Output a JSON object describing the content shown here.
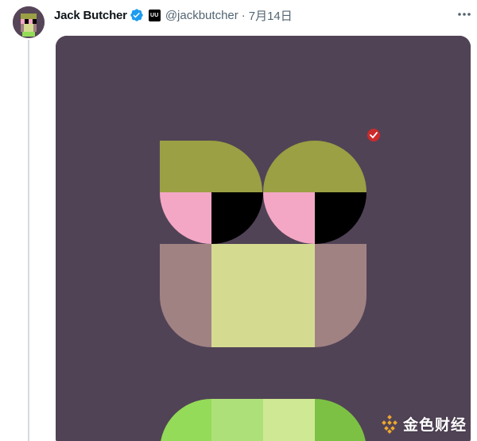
{
  "tweet": {
    "author": {
      "display_name": "Jack Butcher",
      "handle": "@jackbutcher",
      "affiliate_badge": "UU",
      "verified": true,
      "avatar_icon": "pixel-face-avatar"
    },
    "separator": "·",
    "date": "7月14日",
    "more_icon": "more-horizontal-icon"
  },
  "media": {
    "background_color": "#514356",
    "artwork": "geometric-face-illustration",
    "palette": {
      "brow": "#9aa043",
      "cheek": "#f4a7c4",
      "pupil": "#000000",
      "face_side": "#a18283",
      "face_center": "#d4db90",
      "badge": "#cc2b2b",
      "mouth_1": "#93db58",
      "mouth_2": "#aee07a",
      "mouth_3": "#cfe893",
      "mouth_4": "#7cc143"
    }
  },
  "watermark": {
    "text": "金色财经",
    "logo_color": "#f0a92c"
  },
  "colors": {
    "verified_blue": "#1d9bf0",
    "text_primary": "#0f1419",
    "text_secondary": "#536471",
    "thread_line": "#d7dbe0"
  }
}
